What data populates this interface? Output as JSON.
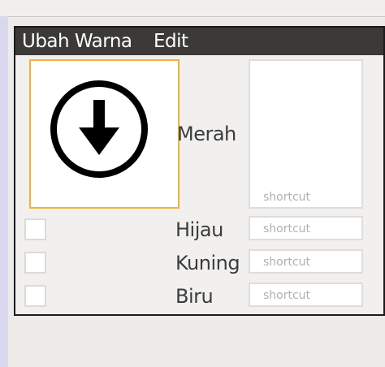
{
  "menubar": {
    "items": [
      {
        "label": "Ubah Warna"
      },
      {
        "label": "Edit"
      }
    ]
  },
  "image_well": {
    "icon": "download-arrow-icon",
    "border_color": "#f0b23a"
  },
  "colors": [
    {
      "label": "Merah",
      "shortcut_placeholder": "shortcut"
    },
    {
      "label": "Hijau",
      "shortcut_placeholder": "shortcut",
      "checked": false
    },
    {
      "label": "Kuning",
      "shortcut_placeholder": "shortcut",
      "checked": false
    },
    {
      "label": "Biru",
      "shortcut_placeholder": "shortcut",
      "checked": false
    }
  ],
  "theme": {
    "menubar_bg": "#3b3a36",
    "window_bg": "#f1f0ef",
    "accent": "#f0b23a"
  }
}
